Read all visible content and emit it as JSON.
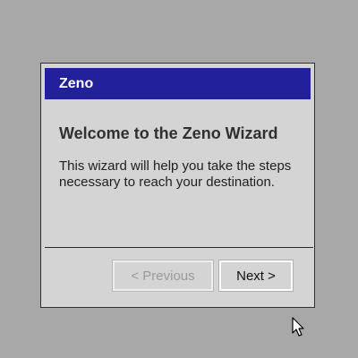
{
  "window": {
    "title": "Zeno"
  },
  "content": {
    "heading": "Welcome to the Zeno Wizard",
    "body": "This wizard will help you take the steps necessary to reach your destination."
  },
  "buttons": {
    "previous_label": "< Previous",
    "previous_enabled": false,
    "next_label": "Next >"
  },
  "colors": {
    "desktop": "#a8a8a8",
    "dialog": "#d4d4d4",
    "titlebar": "#22219b",
    "disabled_text": "#9a9a9a"
  },
  "icons": {
    "cursor": "mouse-pointer-icon"
  }
}
